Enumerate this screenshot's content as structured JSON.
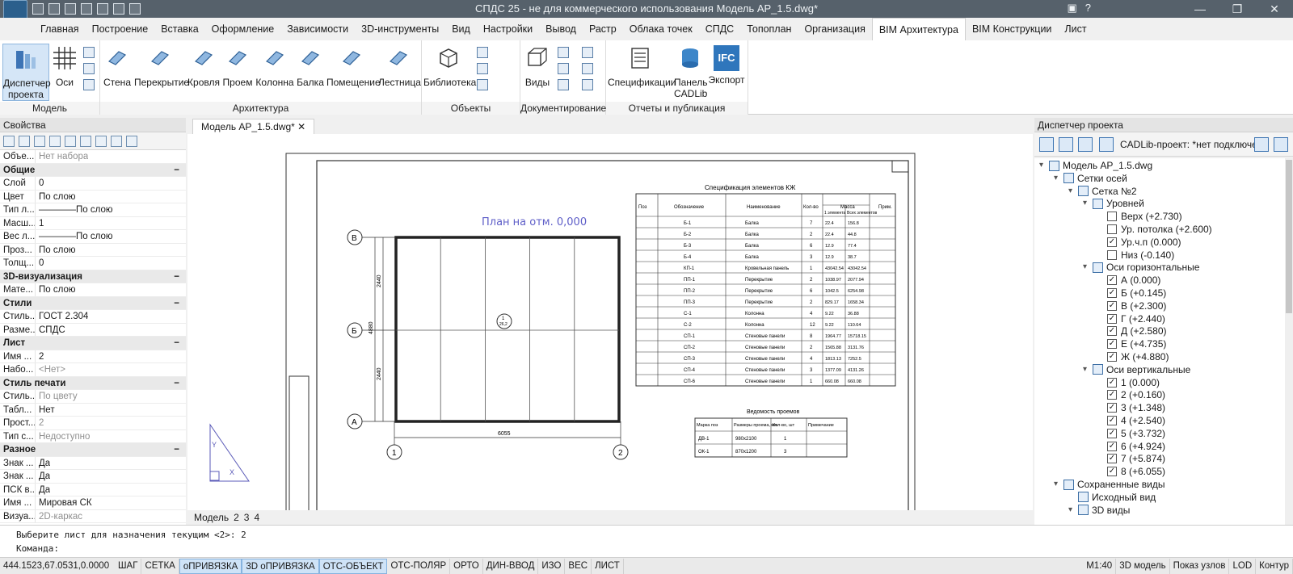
{
  "window": {
    "title": "СПДС 25 - не для коммерческого использования Модель АР_1.5.dwg*",
    "help": "?"
  },
  "tabs": [
    "Главная",
    "Построение",
    "Вставка",
    "Оформление",
    "Зависимости",
    "3D-инструменты",
    "Вид",
    "Настройки",
    "Вывод",
    "Растр",
    "Облака точек",
    "СПДС",
    "Топоплан",
    "Организация",
    "BIM Архитектура",
    "BIM Конструкции",
    "Лист"
  ],
  "active_tab": "BIM Архитектура",
  "ribbon": {
    "model": {
      "label": "Модель",
      "buttons": [
        "Диспетчер проекта",
        "Оси"
      ]
    },
    "arch": {
      "label": "Архитектура",
      "buttons": [
        "Стена",
        "Перекрытие",
        "Кровля",
        "Проем",
        "Колонна",
        "Балка",
        "Помещение",
        "Лестница"
      ]
    },
    "objects": {
      "label": "Объекты",
      "buttons": [
        "Библиотека"
      ]
    },
    "doc": {
      "label": "Документирование",
      "buttons": [
        "Виды"
      ]
    },
    "reports": {
      "label": "Отчеты и публикация",
      "buttons": [
        "Спецификации",
        "Панель CADLib",
        "Экспорт"
      ],
      "ifc": "IFC"
    }
  },
  "props": {
    "header": "Свойства",
    "rows": [
      {
        "k": "Объе...",
        "v": "Нет набора",
        "gray": true
      },
      {
        "sec": "Общие"
      },
      {
        "k": "Слой",
        "v": "0"
      },
      {
        "k": "Цвет",
        "v": "По слою"
      },
      {
        "k": "Тип л...",
        "v": "————По слою"
      },
      {
        "k": "Масш...",
        "v": "1"
      },
      {
        "k": "Вес л...",
        "v": "————По слою"
      },
      {
        "k": "Проз...",
        "v": "По слою"
      },
      {
        "k": "Толщ...",
        "v": "0"
      },
      {
        "sec": "3D-визуализация"
      },
      {
        "k": "Мате...",
        "v": "По слою"
      },
      {
        "sec": "Стили"
      },
      {
        "k": "Стиль...",
        "v": "ГОСТ 2.304"
      },
      {
        "k": "Разме...",
        "v": "СПДС"
      },
      {
        "sec": "Лист"
      },
      {
        "k": "Имя ...",
        "v": "2"
      },
      {
        "k": "Набо...",
        "v": "<Нет>",
        "gray": true
      },
      {
        "sec": "Стиль печати"
      },
      {
        "k": "Стиль...",
        "v": "По цвету",
        "gray": true
      },
      {
        "k": "Табл...",
        "v": "Нет"
      },
      {
        "k": "Прост...",
        "v": "2",
        "gray": true
      },
      {
        "k": "Тип с...",
        "v": "Недоступно",
        "gray": true
      },
      {
        "sec": "Разное"
      },
      {
        "k": "Знак ...",
        "v": "Да"
      },
      {
        "k": "Знак ...",
        "v": "Да"
      },
      {
        "k": "ПСК в...",
        "v": "Да"
      },
      {
        "k": "Имя ...",
        "v": "Мировая СК"
      },
      {
        "k": "Визуа...",
        "v": "2D-каркас",
        "gray": true
      }
    ]
  },
  "doc_tab": "Модель АР_1.5.dwg*",
  "layout_tabs": [
    "Модель",
    "2",
    "3",
    "4"
  ],
  "drawing": {
    "plan_title": "План на отм. 0,000",
    "axes_rows": [
      "В",
      "Б",
      "А"
    ],
    "axes_cols": [
      "1",
      "2"
    ],
    "dim_bottom": "6055",
    "dim_left_total": "4880",
    "dim_left_parts": [
      "2440",
      "2440"
    ],
    "center_mark": "1",
    "center_sub": "26,2",
    "spec_title": "Спецификация элементов КЖ",
    "spec_headers": [
      "Поз",
      "Обозначение",
      "Наименование",
      "Кол-во",
      "Масса",
      "Прим."
    ],
    "spec_mass_headers": [
      "1 элемента",
      "Всех элементов"
    ],
    "spec_rows": [
      [
        "Б-1",
        "Балка",
        "7",
        "22.4",
        "156.8"
      ],
      [
        "Б-2",
        "Балка",
        "2",
        "22.4",
        "44.8"
      ],
      [
        "Б-3",
        "Балка",
        "6",
        "12.9",
        "77.4"
      ],
      [
        "Б-4",
        "Балка",
        "3",
        "12.9",
        "38.7"
      ],
      [
        "КП-1",
        "Кровельная панель",
        "1",
        "43042.54",
        "43042.54"
      ],
      [
        "ПП-1",
        "Перекрытие",
        "2",
        "1038.97",
        "2077.94"
      ],
      [
        "ПП-2",
        "Перекрытие",
        "6",
        "1042.5",
        "6254.98"
      ],
      [
        "ПП-3",
        "Перекрытие",
        "2",
        "829.17",
        "1658.34"
      ],
      [
        "С-1",
        "Колонна",
        "4",
        "9.22",
        "36.88"
      ],
      [
        "С-2",
        "Колонна",
        "12",
        "9.22",
        "110.64"
      ],
      [
        "СП-1",
        "Стеновые панели",
        "8",
        "1964.77",
        "15718.15"
      ],
      [
        "СП-2",
        "Стеновые панели",
        "2",
        "1565.88",
        "3131.76"
      ],
      [
        "СП-3",
        "Стеновые панели",
        "4",
        "1813.13",
        "7252.5"
      ],
      [
        "СП-4",
        "Стеновые панели",
        "3",
        "1377.09",
        "4131.26"
      ],
      [
        "СП-6",
        "Стеновые панели",
        "1",
        "660.08",
        "660.08"
      ]
    ],
    "openings_title": "Ведомость проемов",
    "openings_headers": [
      "Марка поз",
      "Размеры проема, мм",
      "Кол-во, шт",
      "Примечание"
    ],
    "openings_rows": [
      [
        "ДВ-1",
        "980х2100",
        "1",
        ""
      ],
      [
        "ОК-1",
        "870х1200",
        "3",
        ""
      ]
    ],
    "ucs_y": "Y",
    "ucs_x": "X"
  },
  "pm": {
    "header": "Диспетчер проекта",
    "cadlib": "CADLib-проект: *нет подключен",
    "nodes": [
      {
        "t": "Модель АР_1.5.dwg",
        "lvl": 0,
        "exp": "▾",
        "icon": true
      },
      {
        "t": "Сетки осей",
        "lvl": 1,
        "exp": "▾",
        "icon": true
      },
      {
        "t": "Сетка №2",
        "lvl": 2,
        "exp": "▾",
        "icon": true
      },
      {
        "t": "Уровней",
        "lvl": 3,
        "exp": "▾",
        "icon": true
      },
      {
        "t": "Верх (+2.730)",
        "lvl": 4,
        "cb": ""
      },
      {
        "t": "Ур. потолка (+2.600)",
        "lvl": 4,
        "cb": ""
      },
      {
        "t": "Ур.ч.п (0.000)",
        "lvl": 4,
        "cb": "✓"
      },
      {
        "t": "Низ (-0.140)",
        "lvl": 4,
        "cb": ""
      },
      {
        "t": "Оси горизонтальные",
        "lvl": 3,
        "exp": "▾",
        "icon": true
      },
      {
        "t": "А (0.000)",
        "lvl": 4,
        "cb": "✓"
      },
      {
        "t": "Б (+0.145)",
        "lvl": 4,
        "cb": "✓"
      },
      {
        "t": "В (+2.300)",
        "lvl": 4,
        "cb": "✓"
      },
      {
        "t": "Г (+2.440)",
        "lvl": 4,
        "cb": "✓"
      },
      {
        "t": "Д (+2.580)",
        "lvl": 4,
        "cb": "✓"
      },
      {
        "t": "Е (+4.735)",
        "lvl": 4,
        "cb": "✓"
      },
      {
        "t": "Ж (+4.880)",
        "lvl": 4,
        "cb": "✓"
      },
      {
        "t": "Оси вертикальные",
        "lvl": 3,
        "exp": "▾",
        "icon": true
      },
      {
        "t": "1 (0.000)",
        "lvl": 4,
        "cb": "✓"
      },
      {
        "t": "2 (+0.160)",
        "lvl": 4,
        "cb": "✓"
      },
      {
        "t": "3 (+1.348)",
        "lvl": 4,
        "cb": "✓"
      },
      {
        "t": "4 (+2.540)",
        "lvl": 4,
        "cb": "✓"
      },
      {
        "t": "5 (+3.732)",
        "lvl": 4,
        "cb": "✓"
      },
      {
        "t": "6 (+4.924)",
        "lvl": 4,
        "cb": "✓"
      },
      {
        "t": "7 (+5.874)",
        "lvl": 4,
        "cb": "✓"
      },
      {
        "t": "8 (+6.055)",
        "lvl": 4,
        "cb": "✓"
      },
      {
        "t": "Сохраненные виды",
        "lvl": 1,
        "exp": "▾",
        "icon": true
      },
      {
        "t": "Исходный вид",
        "lvl": 2,
        "icon": true
      },
      {
        "t": "3D виды",
        "lvl": 2,
        "exp": "▾",
        "icon": true
      }
    ]
  },
  "cmd": {
    "line1": "Выберите лист для назначения текущим <2>: 2",
    "line2": "Команда:"
  },
  "status": {
    "coords": "444.1523,67.0531,0.0000",
    "buttons": [
      "ШАГ",
      "СЕТКА",
      "оПРИВЯЗКА",
      "3D оПРИВЯЗКА",
      "ОТС-ОБЪЕКТ",
      "ОТС-ПОЛЯР",
      "ОРТО",
      "ДИН-ВВОД",
      "ИЗО",
      "ВЕС",
      "ЛИСТ"
    ],
    "on": [
      "оПРИВЯЗКА",
      "3D оПРИВЯЗКА",
      "ОТС-ОБЪЕКТ"
    ],
    "scale": "M1:40",
    "right": [
      "3D модель",
      "Показ узлов",
      "LOD",
      "Контур"
    ]
  }
}
